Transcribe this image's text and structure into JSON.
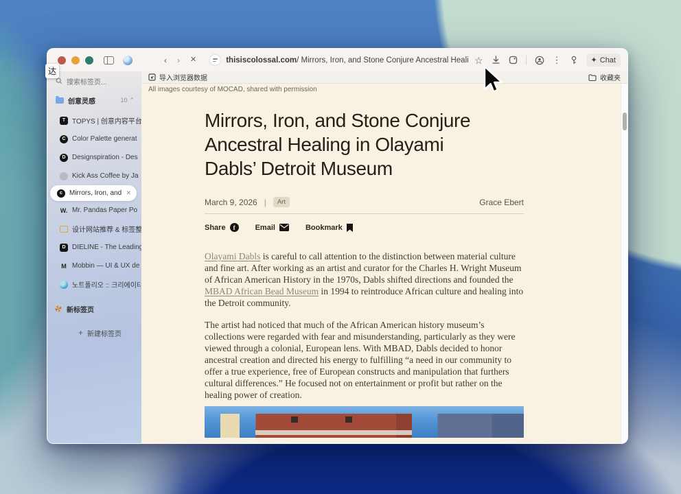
{
  "tooltip": {
    "text": "达"
  },
  "toolbar": {
    "back": "‹",
    "forward": "›",
    "stop": "✕",
    "url_host": "thisiscolossal.com",
    "url_rest": " / Mirrors, Iron, and Stone Conjure Ancestral Healing in Olayami Dabls' ...",
    "chat_label": "Chat",
    "chat_spark": "✦",
    "star": "☆",
    "kebab": "⋮"
  },
  "bookmarks_bar": {
    "import_label": "导入浏览器数据",
    "favorites_label": "收藏夹"
  },
  "sidebar": {
    "search_placeholder": "搜索标签页...",
    "group_label": "创意灵感",
    "group_count": "10",
    "group_caret": "⌃",
    "items": [
      {
        "label": "TOPYS | 创意内容平台",
        "glyph": "T"
      },
      {
        "label": "Color Palette generat",
        "glyph": "C"
      },
      {
        "label": "Designspiration - Des",
        "glyph": "D"
      },
      {
        "label": "Kick Ass Coffee by Ja",
        "glyph": ""
      },
      {
        "label": "Mirrors, Iron, and",
        "glyph": "c"
      },
      {
        "label": "Mr. Pandas Paper Po",
        "glyph": "W."
      },
      {
        "label": "设计网站推荐 & 标签整",
        "glyph": ""
      },
      {
        "label": "DIELINE - The Leading",
        "glyph": "D"
      },
      {
        "label": "Mobbin — UI & UX de",
        "glyph": "M"
      },
      {
        "label": "노트폴리오 :: 크리에이티",
        "glyph": ""
      }
    ],
    "close_glyph": "✕",
    "new_tab_group_label": "新标签页",
    "plus": "+",
    "new_tab_button_label": "新建标签页"
  },
  "article": {
    "caption": "All images courtesy of MOCAD, shared with permission",
    "title_line1": "Mirrors, Iron, and Stone Conjure",
    "title_line2": "Ancestral Healing in Olayami",
    "title_line3": "Dabls’ Detroit Museum",
    "date": "March 9, 2026",
    "meta_sep": "|",
    "category": "Art",
    "author": "Grace Ebert",
    "share_label": "Share",
    "fb_glyph": "f",
    "email_label": "Email",
    "bookmark_label": "Bookmark",
    "p1": {
      "link1": "Olayami Dabls",
      "t1": " is careful to call attention to the distinction between material culture and fine art. After working as an artist and curator for the Charles H. Wright Museum of African American History in the 1970s, Dabls shifted directions and founded the ",
      "link2": "MBAD African Bead Museum",
      "t2": " in 1994 to reintroduce African culture and healing into the Detroit community."
    },
    "p2": "The artist had noticed that much of the African American history museum’s collections were regarded with fear and misunderstanding, particularly as they were viewed through a colonial, European lens. With MBAD, Dabls decided to honor ancestral creation and directed his energy to fulfilling “a need in our community to offer a true experience, free of European constructs and manipulation that furthers cultural differences.” He focused not on entertainment or profit but rather on the healing power of creation."
  },
  "colors": {
    "page_bg": "#f9f2e2",
    "link": "#8d867a",
    "badge_bg": "#e0dac6",
    "traffic_red": "#bb5a4e",
    "traffic_yellow": "#e8a23b",
    "traffic_green": "#2f7d72",
    "wallpaper_navy": "#0c2b88",
    "wallpaper_blue": "#4679ba"
  }
}
